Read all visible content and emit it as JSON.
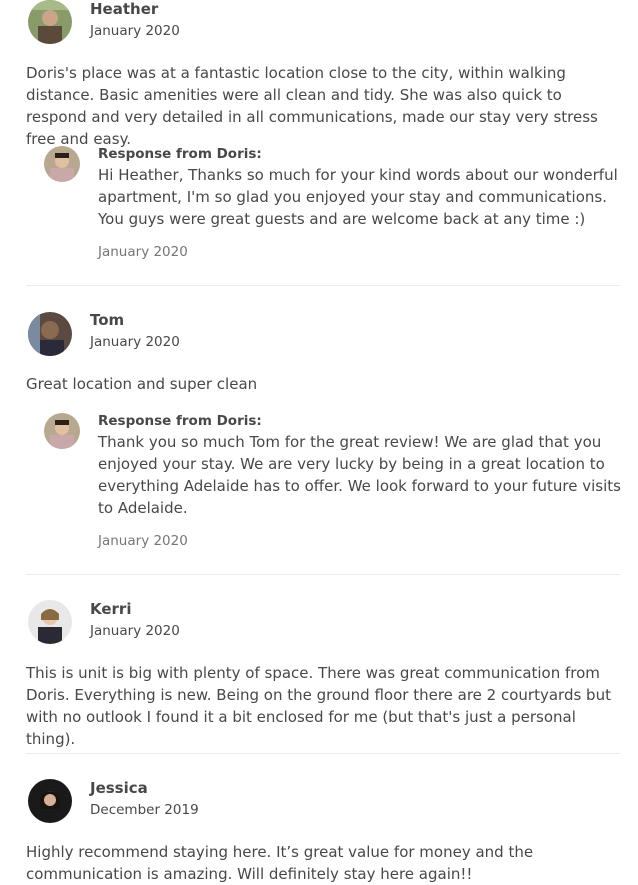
{
  "reviews": [
    {
      "name": "Heather",
      "date": "January 2020",
      "text": "Doris's place was at a fantastic location close to the city, within walking distance. Basic amenities were all clean and tidy. She was also quick to respond and very detailed in all communications, made our stay very stress free and easy.",
      "response": {
        "label": "Response from Doris:",
        "text": "Hi Heather, Thanks so much for your kind words about our wonderful apartment, I'm so glad you enjoyed your stay and communications. You guys were great guests and are welcome back at any time :)",
        "date": "January 2020"
      }
    },
    {
      "name": "Tom",
      "date": "January 2020",
      "text": "Great location and super clean",
      "response": {
        "label": "Response from Doris:",
        "text": "Thank you so much Tom for the great review! We are glad that you enjoyed your stay. We are very lucky by being in a great location to everything Adelaide has to offer. We look forward to your future visits to Adelaide.",
        "date": "January 2020"
      }
    },
    {
      "name": "Kerri",
      "date": "January 2020",
      "text": "This is unit is big with plenty of space. There was great communication from Doris. Everything is new. Being on the ground floor there are 2 courtyards but with no outlook I found it a bit enclosed for me (but that's just a personal thing)."
    },
    {
      "name": "Jessica",
      "date": "December 2019",
      "text": "Highly recommend staying here. It’s great value for money and the communication is amazing. Will definitely stay here again!!"
    }
  ]
}
